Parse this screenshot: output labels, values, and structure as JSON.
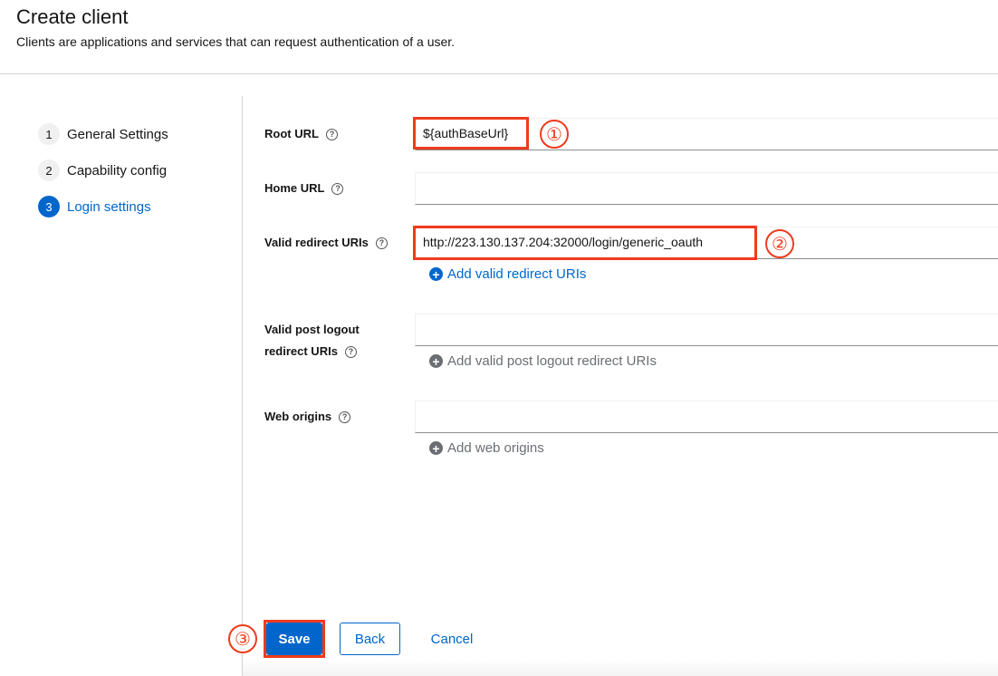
{
  "header": {
    "title": "Create client",
    "subtitle": "Clients are applications and services that can request authentication of a user."
  },
  "wizard": {
    "steps": [
      {
        "num": "1",
        "label": "General Settings",
        "active": false
      },
      {
        "num": "2",
        "label": "Capability config",
        "active": false
      },
      {
        "num": "3",
        "label": "Login settings",
        "active": true
      }
    ]
  },
  "form": {
    "root_url": {
      "label": "Root URL",
      "value": "${authBaseUrl}"
    },
    "home_url": {
      "label": "Home URL",
      "value": ""
    },
    "valid_redirect_uris": {
      "label": "Valid redirect URIs",
      "value": "http://223.130.137.204:32000/login/generic_oauth",
      "add_label": "Add valid redirect URIs"
    },
    "valid_post_logout": {
      "label_line1": "Valid post logout",
      "label_line2": "redirect URIs",
      "value": "",
      "add_label": "Add valid post logout redirect URIs"
    },
    "web_origins": {
      "label": "Web origins",
      "value": "",
      "add_label": "Add web origins"
    }
  },
  "annotations": {
    "one": "①",
    "two": "②",
    "three": "③"
  },
  "footer": {
    "save": "Save",
    "back": "Back",
    "cancel": "Cancel"
  },
  "icons": {
    "help": "?",
    "plus": "+"
  },
  "colors": {
    "accent": "#0066cc",
    "highlight": "#ee3b1d"
  }
}
